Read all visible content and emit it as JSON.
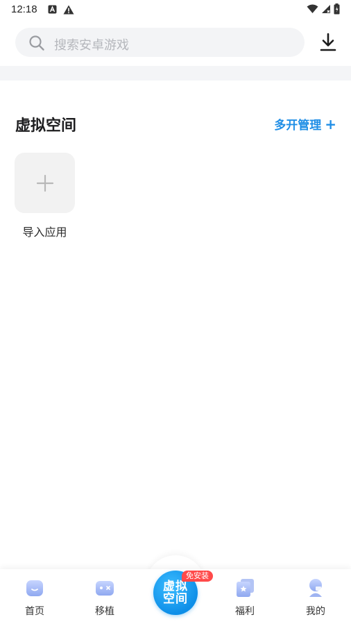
{
  "status_bar": {
    "time": "12:18"
  },
  "search": {
    "placeholder": "搜索安卓游戏"
  },
  "section": {
    "title": "虚拟空间",
    "manage_label": "多开管理",
    "manage_plus": "+"
  },
  "import_app": {
    "label": "导入应用"
  },
  "bottom_nav": {
    "items": [
      {
        "label": "首页",
        "icon": "home-icon"
      },
      {
        "label": "移植",
        "icon": "gamepad-icon"
      },
      {
        "label": "福利",
        "icon": "gift-card-icon"
      },
      {
        "label": "我的",
        "icon": "profile-icon"
      }
    ],
    "center": {
      "line1": "虚拟",
      "line2": "空间",
      "badge": "免安装"
    }
  },
  "colors": {
    "accent": "#1f8ee6",
    "badge": "#ff4a4a",
    "center_button": "#0e8fe8"
  }
}
